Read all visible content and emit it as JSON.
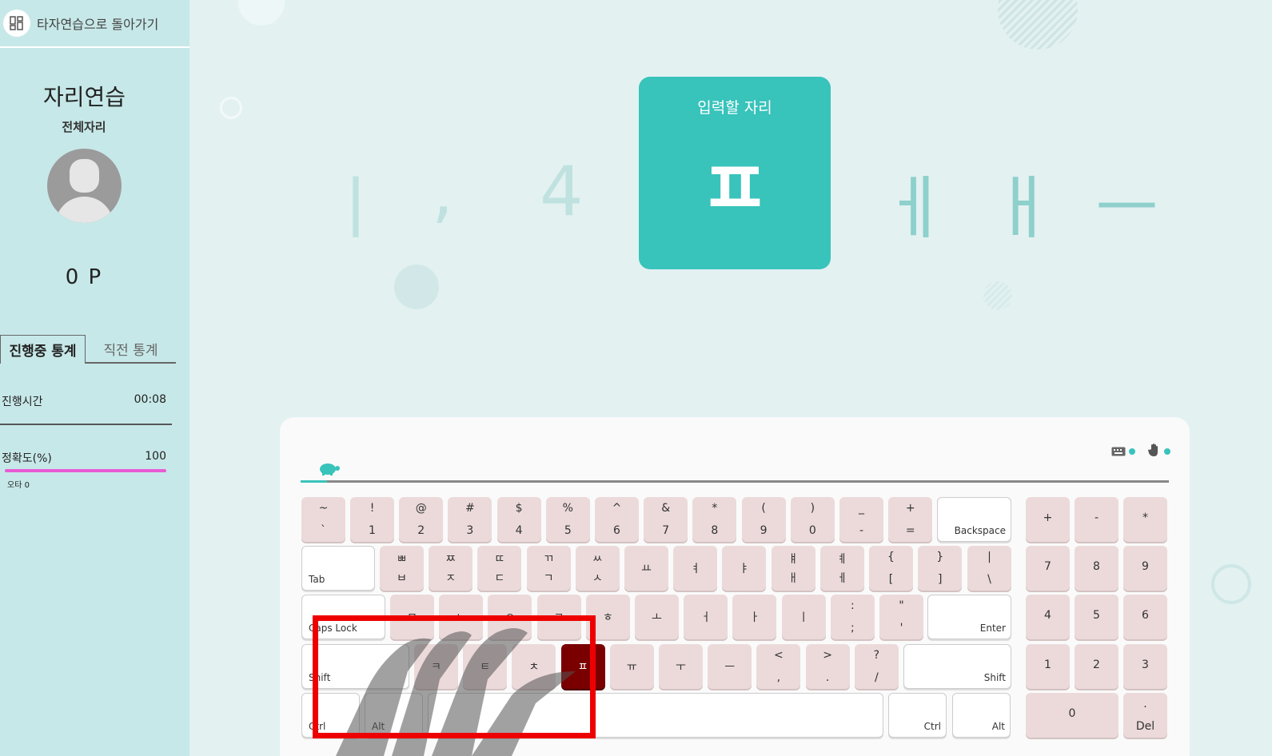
{
  "header": {
    "back_label": "타자연습으로 돌아가기",
    "back_icon": "grid-icon"
  },
  "sidebar": {
    "title": "자리연습",
    "subtitle": "전체자리",
    "points": "0 P",
    "tabs": [
      {
        "label": "진행중 통계"
      },
      {
        "label": "직전 통계"
      }
    ],
    "stats": {
      "time_label": "진행시간",
      "time_value": "00:08",
      "accuracy_label": "정확도(%)",
      "accuracy_value": "100",
      "typo_label": "오타 0"
    }
  },
  "preview": {
    "prev": [
      "ㅣ",
      ",",
      "4"
    ],
    "current_label": "입력할 자리",
    "current": "ㅍ",
    "next": [
      "ㅔ",
      "ㅐ",
      "ㅡ"
    ]
  },
  "keyboard": {
    "progress": 0.03,
    "accent": "#38c3bb",
    "active_color": "#7a0000",
    "icons": [
      "keyboard-icon",
      "hand-icon",
      "turtle-icon"
    ],
    "row1": [
      {
        "t": "~",
        "b": "`"
      },
      {
        "t": "!",
        "b": "1"
      },
      {
        "t": "@",
        "b": "2"
      },
      {
        "t": "#",
        "b": "3"
      },
      {
        "t": "$",
        "b": "4"
      },
      {
        "t": "%",
        "b": "5"
      },
      {
        "t": "^",
        "b": "6"
      },
      {
        "t": "&",
        "b": "7"
      },
      {
        "t": "*",
        "b": "8"
      },
      {
        "t": "(",
        "b": "9"
      },
      {
        "t": ")",
        "b": "0"
      },
      {
        "t": "_",
        "b": "-"
      },
      {
        "t": "+",
        "b": "="
      },
      {
        "t": "",
        "b": "Backspace"
      }
    ],
    "row2": [
      {
        "t": "",
        "b": "Tab"
      },
      {
        "t": "ㅃ",
        "b": "ㅂ"
      },
      {
        "t": "ㅉ",
        "b": "ㅈ"
      },
      {
        "t": "ㄸ",
        "b": "ㄷ"
      },
      {
        "t": "ㄲ",
        "b": "ㄱ"
      },
      {
        "t": "ㅆ",
        "b": "ㅅ"
      },
      {
        "t": "",
        "b": "ㅛ"
      },
      {
        "t": "",
        "b": "ㅕ"
      },
      {
        "t": "",
        "b": "ㅑ"
      },
      {
        "t": "ㅒ",
        "b": "ㅐ"
      },
      {
        "t": "ㅖ",
        "b": "ㅔ"
      },
      {
        "t": "{",
        "b": "["
      },
      {
        "t": "}",
        "b": "]"
      },
      {
        "t": "|",
        "b": "\\"
      }
    ],
    "row3": [
      {
        "t": "",
        "b": "Caps Lock"
      },
      {
        "t": "",
        "b": "ㅁ"
      },
      {
        "t": "",
        "b": "ㄴ"
      },
      {
        "t": "",
        "b": "ㅇ"
      },
      {
        "t": "",
        "b": "ㄹ"
      },
      {
        "t": "",
        "b": "ㅎ"
      },
      {
        "t": "",
        "b": "ㅗ"
      },
      {
        "t": "",
        "b": "ㅓ"
      },
      {
        "t": "",
        "b": "ㅏ"
      },
      {
        "t": "",
        "b": "ㅣ"
      },
      {
        "t": ":",
        "b": ";"
      },
      {
        "t": "\"",
        "b": "'"
      },
      {
        "t": "",
        "b": "Enter"
      }
    ],
    "row4": [
      {
        "t": "",
        "b": "Shift"
      },
      {
        "t": "",
        "b": "ㅋ"
      },
      {
        "t": "",
        "b": "ㅌ"
      },
      {
        "t": "",
        "b": "ㅊ"
      },
      {
        "t": "",
        "b": "ㅍ"
      },
      {
        "t": "",
        "b": "ㅠ"
      },
      {
        "t": "",
        "b": "ㅜ"
      },
      {
        "t": "",
        "b": "ㅡ"
      },
      {
        "t": "<",
        "b": ","
      },
      {
        "t": ">",
        "b": "."
      },
      {
        "t": "?",
        "b": "/"
      },
      {
        "t": "",
        "b": "Shift"
      }
    ],
    "row5": [
      {
        "b": "Ctrl"
      },
      {
        "b": "Alt"
      },
      {
        "b": ""
      },
      {
        "b": "Ctrl"
      },
      {
        "b": "Alt"
      }
    ],
    "numpad": [
      {
        "t": "+"
      },
      {
        "t": "-"
      },
      {
        "t": "*"
      },
      {
        "t": "7"
      },
      {
        "t": "8"
      },
      {
        "t": "9"
      },
      {
        "t": "4"
      },
      {
        "t": "5"
      },
      {
        "t": "6"
      },
      {
        "t": "1"
      },
      {
        "t": "2"
      },
      {
        "t": "3"
      },
      {
        "t": "0"
      },
      {
        "t": ".",
        "b": "Del"
      }
    ]
  }
}
